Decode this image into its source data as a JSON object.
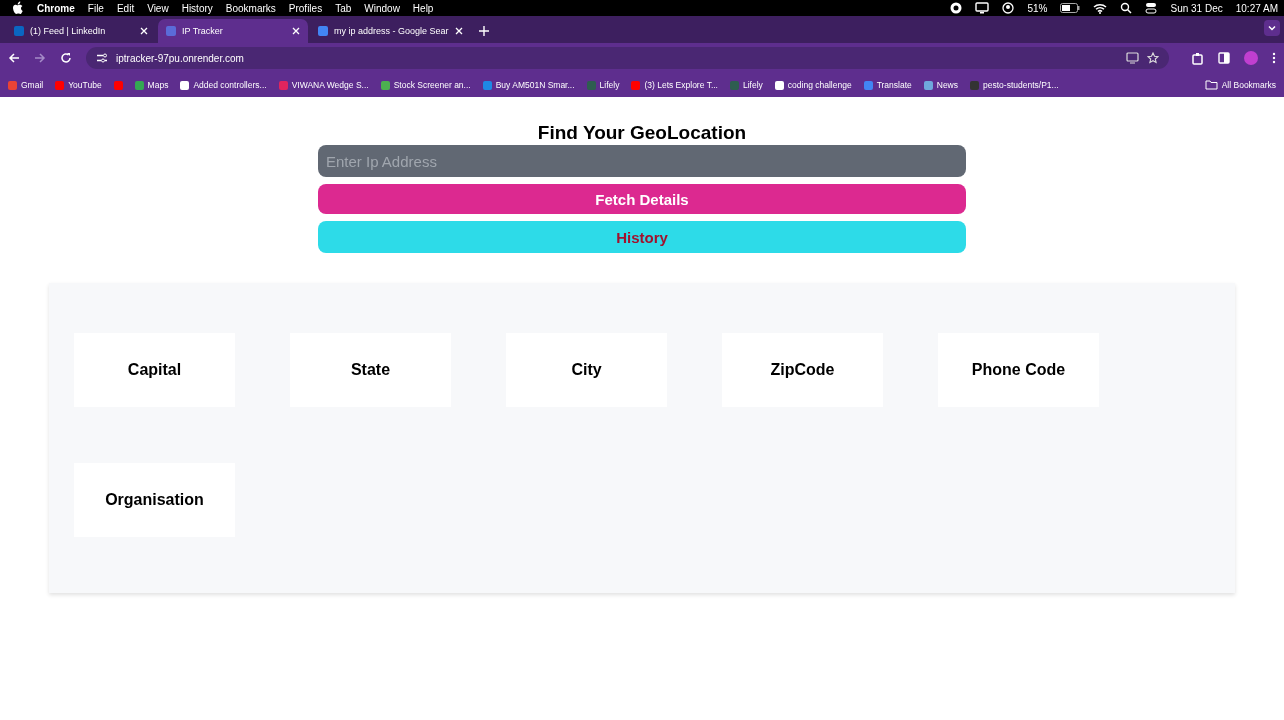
{
  "menu_bar": {
    "app": "Chrome",
    "items": [
      "File",
      "Edit",
      "View",
      "History",
      "Bookmarks",
      "Profiles",
      "Tab",
      "Window",
      "Help"
    ],
    "battery": "51%",
    "date": "Sun 31 Dec",
    "time": "10:27 AM"
  },
  "tabs": [
    {
      "title": "(1) Feed | LinkedIn",
      "selected": false,
      "color": "#0a66c2"
    },
    {
      "title": "IP Tracker",
      "selected": true,
      "color": "#5b6bd8"
    },
    {
      "title": "my ip address - Google Sear",
      "selected": false,
      "color": "#4285f4"
    }
  ],
  "address_bar": {
    "url": "iptracker-97pu.onrender.com"
  },
  "bookmarks": [
    {
      "label": "Gmail",
      "color": "#ea4335"
    },
    {
      "label": "YouTube",
      "color": "#ff0000"
    },
    {
      "color": "#ff0000"
    },
    {
      "label": "Maps",
      "color": "#34a853"
    },
    {
      "label": "Added controllers...",
      "color": "#ffffff"
    },
    {
      "label": "VIWANA Wedge S...",
      "color": "#e0245e"
    },
    {
      "label": "Stock Screener an...",
      "color": "#4caf50"
    },
    {
      "label": "Buy AM501N Smar...",
      "color": "#1e88e5"
    },
    {
      "label": "Lifely",
      "color": "#2e5d50"
    },
    {
      "label": "(3) Lets Explore T...",
      "color": "#ff0000"
    },
    {
      "label": "Lifely",
      "color": "#2e5d50"
    },
    {
      "label": "coding challenge",
      "color": "#ffffff"
    },
    {
      "label": "Translate",
      "color": "#4285f4"
    },
    {
      "label": "News",
      "color": "#6fa8dc"
    },
    {
      "label": "pesto-students/P1...",
      "color": "#333333"
    }
  ],
  "all_bookmarks": "All Bookmarks",
  "page": {
    "title": "Find Your GeoLocation",
    "ip_field": {
      "placeholder": "Enter Ip Address"
    },
    "buttons": [
      {
        "label": "Fetch Details",
        "kind": "primary"
      },
      {
        "label": "History",
        "kind": "secondary"
      }
    ],
    "cards": [
      "Capital",
      "State",
      "City",
      "ZipCode",
      "Phone Code",
      "Organisation"
    ]
  }
}
